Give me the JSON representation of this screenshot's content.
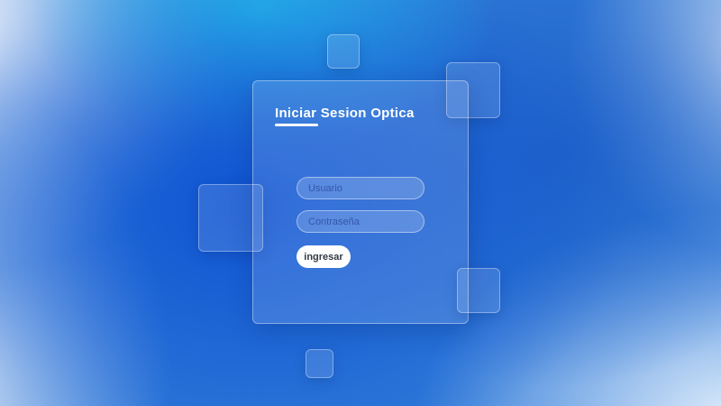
{
  "login": {
    "title": "Iniciar Sesion Optica",
    "username": {
      "placeholder": "Usuario",
      "value": ""
    },
    "password": {
      "placeholder": "Contraseña",
      "value": ""
    },
    "submit_label": "ingresar"
  }
}
